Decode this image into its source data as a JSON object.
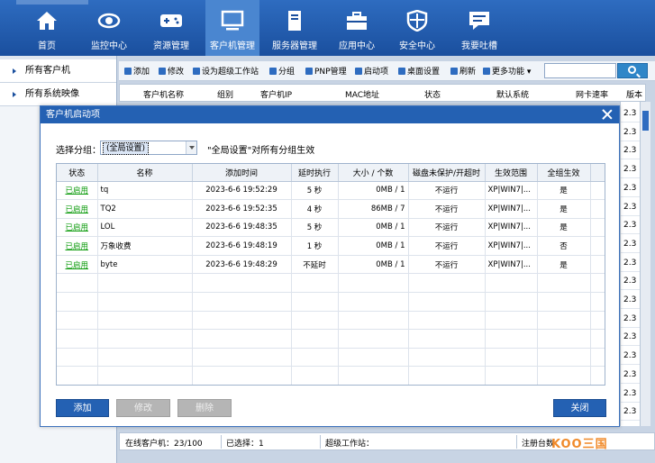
{
  "nav": {
    "items": [
      {
        "label": "首页",
        "icon": "home-icon"
      },
      {
        "label": "监控中心",
        "icon": "eye-icon"
      },
      {
        "label": "资源管理",
        "icon": "gamepad-icon"
      },
      {
        "label": "客户机管理",
        "icon": "monitor-icon"
      },
      {
        "label": "服务器管理",
        "icon": "server-icon"
      },
      {
        "label": "应用中心",
        "icon": "toolbox-icon"
      },
      {
        "label": "安全中心",
        "icon": "shield-icon"
      },
      {
        "label": "我要吐槽",
        "icon": "chat-icon"
      }
    ],
    "active_index": 3
  },
  "sidebar": {
    "items": [
      {
        "label": "所有客户机"
      },
      {
        "label": "所有系统映像"
      }
    ]
  },
  "toolbar": {
    "items": [
      "添加",
      "修改",
      "设为超级工作站",
      "分组",
      "PNP管理",
      "启动项",
      "桌面设置",
      "刷新",
      "更多功能"
    ]
  },
  "bg_table": {
    "headers": [
      "客户机名称",
      "组别",
      "客户机IP",
      "MAC地址",
      "状态",
      "默认系统",
      "网卡速率",
      "版本"
    ],
    "version_cells": [
      "2.3",
      "2.3",
      "2.3",
      "2.3",
      "2.3",
      "2.3",
      "2.3",
      "2.3",
      "2.3",
      "2.3",
      "2.3",
      "2.3",
      "2.3",
      "2.3",
      "2.3",
      "2.3",
      "2.3"
    ]
  },
  "statusbar": {
    "online": "在线客户机：23/100",
    "selected": "已选择：1",
    "super": "超级工作站：",
    "register": "注册台数"
  },
  "watermark": "KOO三国",
  "dialog": {
    "title": "客户机启动项",
    "group_label": "选择分组：",
    "group_value": "(全局设置)",
    "group_note": "\"全局设置\"对所有分组生效",
    "columns": [
      "状态",
      "名称",
      "添加时间",
      "延时执行",
      "大小 / 个数",
      "磁盘未保护/开超时",
      "生效范围",
      "全组生效"
    ],
    "rows": [
      {
        "status": "已启用",
        "name": "tq",
        "time": "2023-6-6 19:52:29",
        "delay": "5 秒",
        "size": "0MB",
        "count": "1",
        "disk": "不运行",
        "scope": "XP|WIN7|...",
        "all": "是"
      },
      {
        "status": "已启用",
        "name": "TQ2",
        "time": "2023-6-6 19:52:35",
        "delay": "4 秒",
        "size": "86MB",
        "count": "7",
        "disk": "不运行",
        "scope": "XP|WIN7|...",
        "all": "是"
      },
      {
        "status": "已启用",
        "name": "LOL",
        "time": "2023-6-6 19:48:35",
        "delay": "5 秒",
        "size": "0MB",
        "count": "1",
        "disk": "不运行",
        "scope": "XP|WIN7|...",
        "all": "是"
      },
      {
        "status": "已启用",
        "name": "万象收费",
        "time": "2023-6-6 19:48:19",
        "delay": "1 秒",
        "size": "0MB",
        "count": "1",
        "disk": "不运行",
        "scope": "XP|WIN7|...",
        "all": "否"
      },
      {
        "status": "已启用",
        "name": "byte",
        "time": "2023-6-6 19:48:29",
        "delay": "不延时",
        "size": "0MB",
        "count": "1",
        "disk": "不运行",
        "scope": "XP|WIN7|...",
        "all": "是"
      }
    ],
    "buttons": {
      "add": "添加",
      "edit": "修改",
      "delete": "删除",
      "close": "关闭"
    }
  }
}
